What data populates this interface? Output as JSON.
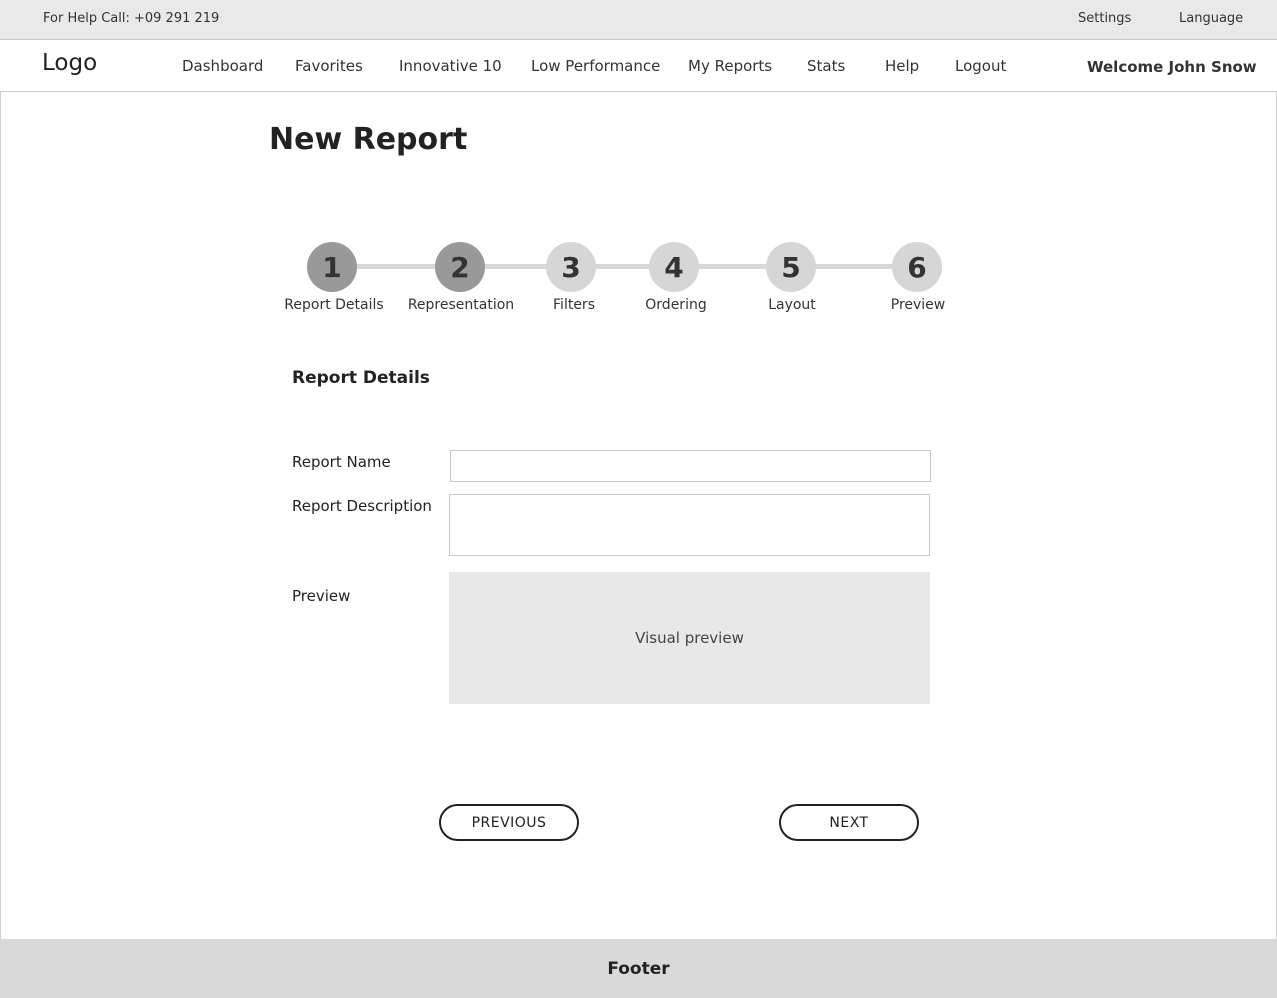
{
  "topbar": {
    "help_text": "For Help Call: +09 291 219",
    "settings_label": "Settings",
    "language_label": "Language"
  },
  "navbar": {
    "logo": "Logo",
    "items": [
      {
        "label": "Dashboard"
      },
      {
        "label": "Favorites"
      },
      {
        "label": "Innovative 10"
      },
      {
        "label": "Low Performance"
      },
      {
        "label": "My Reports"
      },
      {
        "label": "Stats"
      },
      {
        "label": "Help"
      },
      {
        "label": "Logout"
      }
    ],
    "welcome": "Welcome John Snow"
  },
  "page": {
    "title": "New Report"
  },
  "stepper": {
    "steps": [
      {
        "number": "1",
        "label": "Report Details",
        "state": "active"
      },
      {
        "number": "2",
        "label": "Representation",
        "state": "active"
      },
      {
        "number": "3",
        "label": "Filters",
        "state": "inactive"
      },
      {
        "number": "4",
        "label": "Ordering",
        "state": "inactive"
      },
      {
        "number": "5",
        "label": "Layout",
        "state": "inactive"
      },
      {
        "number": "6",
        "label": "Preview",
        "state": "inactive"
      }
    ]
  },
  "form": {
    "section_title": "Report Details",
    "name_label": "Report Name",
    "name_value": "",
    "description_label": "Report Description",
    "description_value": "",
    "preview_label": "Preview",
    "preview_placeholder": "Visual preview"
  },
  "actions": {
    "previous_label": "PREVIOUS",
    "next_label": "NEXT"
  },
  "footer": {
    "text": "Footer"
  },
  "colors": {
    "topbar_bg": "#e9e9e9",
    "step_active": "#999999",
    "step_inactive": "#d6d6d6",
    "preview_bg": "#e8e8e8",
    "footer_bg": "#d9d9d9"
  }
}
